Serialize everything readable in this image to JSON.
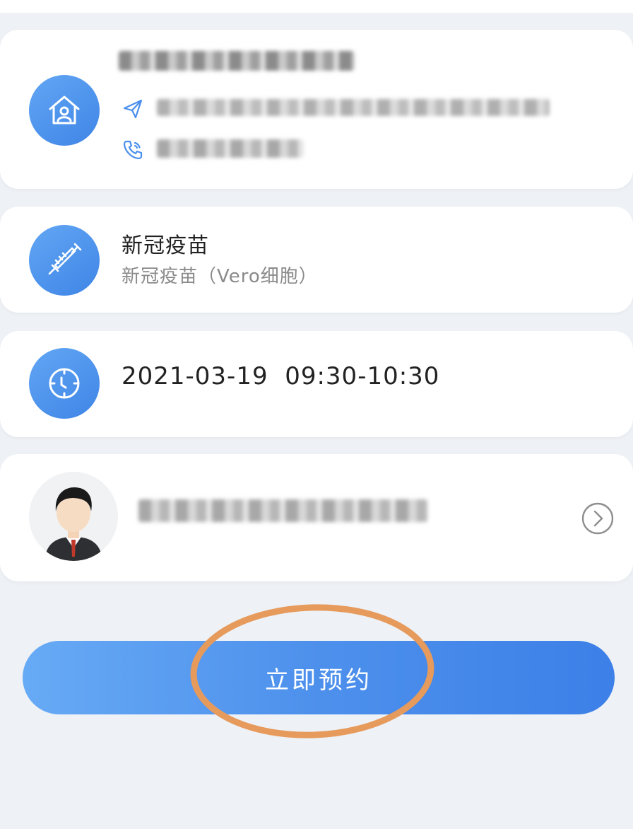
{
  "clinic": {
    "name_redacted": "",
    "address_redacted": "",
    "phone_redacted": "",
    "icon": "home-clinic-icon",
    "address_icon": "send-arrow-icon",
    "phone_icon": "phone-icon"
  },
  "vaccine": {
    "title": "新冠疫苗",
    "subtitle": "新冠疫苗（Vero细胞）",
    "icon": "syringe-icon"
  },
  "appointment": {
    "datetime": "2021-03-19  09:30-10:30",
    "icon": "clock-icon"
  },
  "person": {
    "name_redacted": "",
    "avatar_icon": "avatar-icon",
    "chevron_icon": "chevron-right-circle-icon"
  },
  "actions": {
    "book_label": "立即预约"
  },
  "colors": {
    "accent": "#4a8fed",
    "highlight": "#e69a5c",
    "background": "#eef1f5"
  }
}
